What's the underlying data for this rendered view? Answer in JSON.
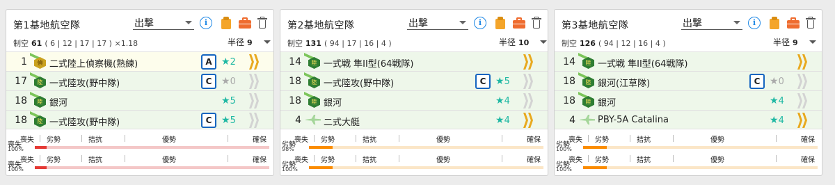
{
  "panels": [
    {
      "title": "第1基地航空隊",
      "mode": "出撃",
      "air_label": "制空",
      "air_value": "61",
      "air_detail": "( 6 | 12 | 17 | 17 ) ×1.18",
      "radius_label": "半径",
      "radius_value": "9",
      "slots": [
        {
          "count": "1",
          "icon": "gold-hex",
          "badge": "偵",
          "name": "二式陸上偵察機(熟練)",
          "prof": "A",
          "star": "★",
          "level": "2",
          "stars_color": "teal",
          "chev": "gold",
          "bg": "y"
        },
        {
          "count": "17",
          "icon": "green-hex",
          "badge": "陸",
          "name": "一式陸攻(野中隊)",
          "prof": "C",
          "star": "★",
          "level": "0",
          "stars_color": "grey",
          "chev": "dim",
          "bg": "g"
        },
        {
          "count": "18",
          "icon": "green-hex",
          "badge": "陸",
          "name": "銀河",
          "prof": "",
          "star": "★",
          "level": "5",
          "stars_color": "teal",
          "chev": "dim",
          "bg": "g"
        },
        {
          "count": "18",
          "icon": "green-hex",
          "badge": "陸",
          "name": "一式陸攻(野中隊)",
          "prof": "C",
          "star": "★",
          "level": "5",
          "stars_color": "teal",
          "chev": "dim",
          "bg": "g"
        }
      ],
      "air_bars": [
        {
          "first": "喪失",
          "labels": [
            "喪失",
            "劣勢",
            "拮抗",
            "優勢",
            "確保"
          ],
          "pct": "100%",
          "fill": 0.05,
          "color": "red"
        },
        {
          "first": "喪失",
          "labels": [
            "喪失",
            "劣勢",
            "拮抗",
            "優勢",
            "確保"
          ],
          "pct": "100%",
          "fill": 0.05,
          "color": "red"
        }
      ]
    },
    {
      "title": "第2基地航空隊",
      "mode": "出撃",
      "air_label": "制空",
      "air_value": "131",
      "air_detail": "( 94 | 17 | 16 | 4 )",
      "radius_label": "半径",
      "radius_value": "10",
      "slots": [
        {
          "count": "14",
          "icon": "green-hex",
          "badge": "陸",
          "name": "一式戦 隼II型(64戦隊)",
          "prof": "",
          "star": "",
          "level": "",
          "stars_color": "teal",
          "chev": "gold",
          "bg": "g"
        },
        {
          "count": "18",
          "icon": "green-hex",
          "badge": "陸",
          "name": "一式陸攻(野中隊)",
          "prof": "C",
          "star": "★",
          "level": "5",
          "stars_color": "teal",
          "chev": "dim",
          "bg": "g"
        },
        {
          "count": "18",
          "icon": "green-hex",
          "badge": "陸",
          "name": "銀河",
          "prof": "",
          "star": "★",
          "level": "4",
          "stars_color": "teal",
          "chev": "dim",
          "bg": "g"
        },
        {
          "count": "4",
          "icon": "plane",
          "badge": "",
          "name": "二式大艇",
          "prof": "",
          "star": "★",
          "level": "4",
          "stars_color": "teal",
          "chev": "gold",
          "bg": "g"
        }
      ],
      "air_bars": [
        {
          "first": "劣勢",
          "labels": [
            "喪失",
            "劣勢",
            "拮抗",
            "優勢",
            "確保"
          ],
          "pct": "98%",
          "fill": 0.1,
          "color": "orange"
        },
        {
          "first": "劣勢",
          "labels": [
            "喪失",
            "劣勢",
            "拮抗",
            "優勢",
            "確保"
          ],
          "pct": "100%",
          "fill": 0.1,
          "color": "orange"
        }
      ]
    },
    {
      "title": "第3基地航空隊",
      "mode": "出撃",
      "air_label": "制空",
      "air_value": "126",
      "air_detail": "( 94 | 12 | 16 | 4 )",
      "radius_label": "半径",
      "radius_value": "9",
      "slots": [
        {
          "count": "14",
          "icon": "green-hex",
          "badge": "陸",
          "name": "一式戦 隼II型(64戦隊)",
          "prof": "",
          "star": "",
          "level": "",
          "stars_color": "teal",
          "chev": "gold",
          "bg": "g"
        },
        {
          "count": "18",
          "icon": "green-hex",
          "badge": "陸",
          "name": "銀河(江草隊)",
          "prof": "C",
          "star": "★",
          "level": "0",
          "stars_color": "grey",
          "chev": "dim",
          "bg": "g"
        },
        {
          "count": "18",
          "icon": "green-hex",
          "badge": "陸",
          "name": "銀河",
          "prof": "",
          "star": "★",
          "level": "4",
          "stars_color": "teal",
          "chev": "dim",
          "bg": "g"
        },
        {
          "count": "4",
          "icon": "plane",
          "badge": "",
          "name": "PBY-5A Catalina",
          "prof": "",
          "star": "★",
          "level": "4",
          "stars_color": "teal",
          "chev": "gold",
          "bg": "g"
        }
      ],
      "air_bars": [
        {
          "first": "劣勢",
          "labels": [
            "喪失",
            "劣勢",
            "拮抗",
            "優勢",
            "確保"
          ],
          "pct": "100%",
          "fill": 0.1,
          "color": "orange"
        },
        {
          "first": "劣勢",
          "labels": [
            "喪失",
            "劣勢",
            "拮抗",
            "優勢",
            "確保"
          ],
          "pct": "100%",
          "fill": 0.1,
          "color": "orange"
        }
      ]
    }
  ]
}
